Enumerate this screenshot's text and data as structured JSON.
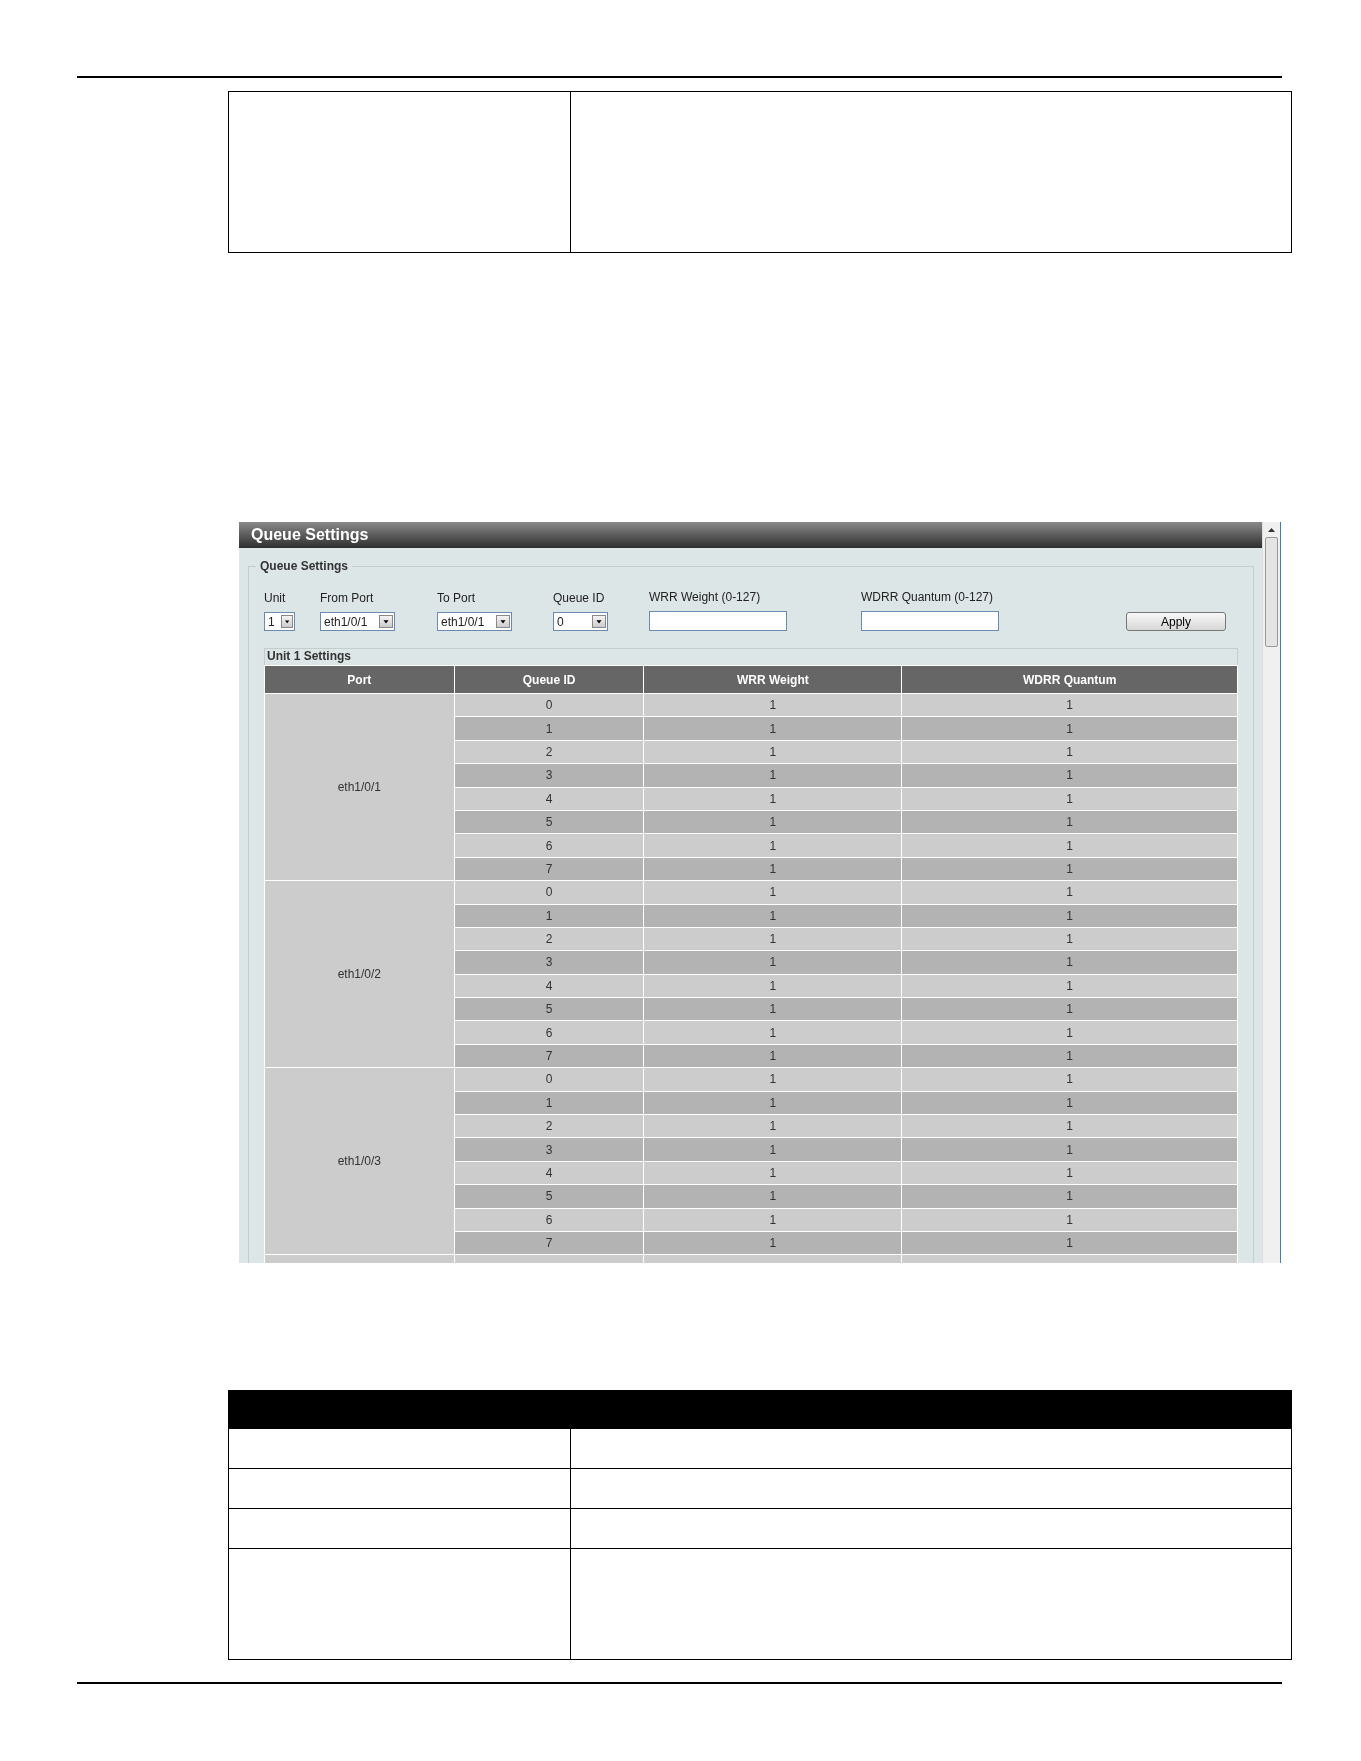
{
  "window": {
    "title": "Queue Settings"
  },
  "form": {
    "legend": "Queue Settings",
    "fields": [
      {
        "kind": "select",
        "label": "Unit",
        "value": "1"
      },
      {
        "kind": "select",
        "label": "From Port",
        "value": "eth1/0/1"
      },
      {
        "kind": "select",
        "label": "To Port",
        "value": "eth1/0/1"
      },
      {
        "kind": "select",
        "label": "Queue ID",
        "value": "0"
      },
      {
        "kind": "text",
        "label": "WRR Weight (0-127)"
      },
      {
        "kind": "text",
        "label": "WDRR Quantum (0-127)"
      }
    ],
    "button": "Apply"
  },
  "table": {
    "title": "Unit 1 Settings",
    "columns": [
      "Port",
      "Queue ID",
      "WRR Weight",
      "WDRR Quantum"
    ],
    "groups": [
      {
        "port": "eth1/0/1",
        "rows": [
          [
            "0",
            "1",
            "1"
          ],
          [
            "1",
            "1",
            "1"
          ],
          [
            "2",
            "1",
            "1"
          ],
          [
            "3",
            "1",
            "1"
          ],
          [
            "4",
            "1",
            "1"
          ],
          [
            "5",
            "1",
            "1"
          ],
          [
            "6",
            "1",
            "1"
          ],
          [
            "7",
            "1",
            "1"
          ]
        ]
      },
      {
        "port": "eth1/0/2",
        "rows": [
          [
            "0",
            "1",
            "1"
          ],
          [
            "1",
            "1",
            "1"
          ],
          [
            "2",
            "1",
            "1"
          ],
          [
            "3",
            "1",
            "1"
          ],
          [
            "4",
            "1",
            "1"
          ],
          [
            "5",
            "1",
            "1"
          ],
          [
            "6",
            "1",
            "1"
          ],
          [
            "7",
            "1",
            "1"
          ]
        ]
      },
      {
        "port": "eth1/0/3",
        "rows": [
          [
            "0",
            "1",
            "1"
          ],
          [
            "1",
            "1",
            "1"
          ],
          [
            "2",
            "1",
            "1"
          ],
          [
            "3",
            "1",
            "1"
          ],
          [
            "4",
            "1",
            "1"
          ],
          [
            "5",
            "1",
            "1"
          ],
          [
            "6",
            "1",
            "1"
          ],
          [
            "7",
            "1",
            "1"
          ]
        ]
      }
    ]
  }
}
